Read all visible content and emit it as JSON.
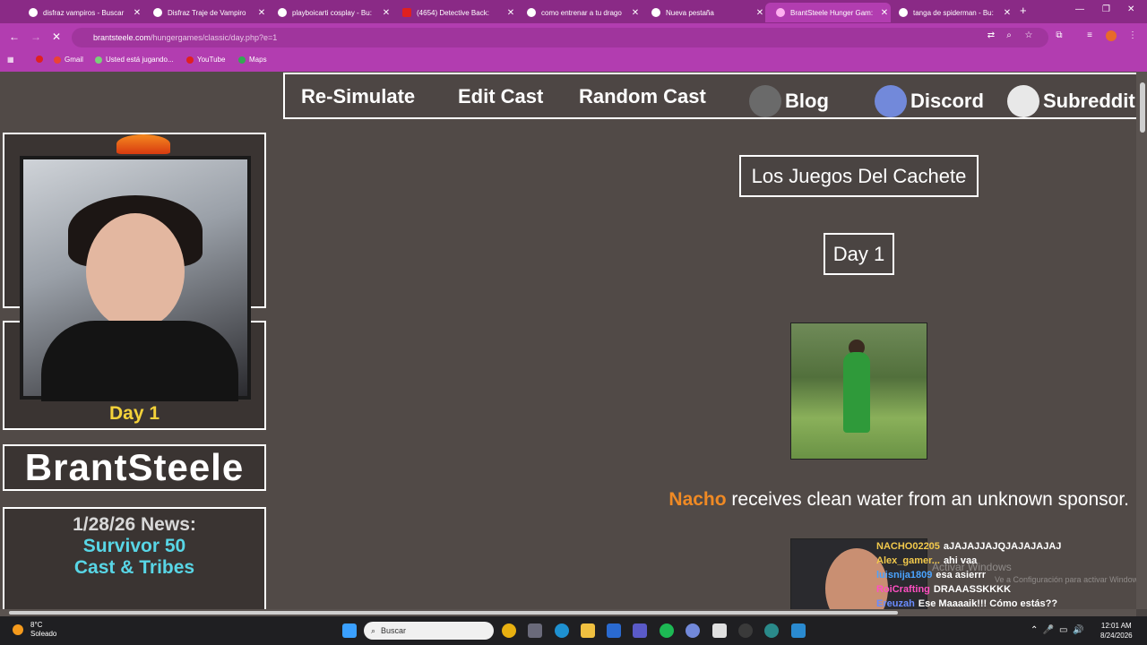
{
  "browser": {
    "tabs": [
      {
        "title": "disfraz vampiros - Buscar",
        "active": false
      },
      {
        "title": "Disfraz Traje de Vampiro",
        "active": false
      },
      {
        "title": "playboicarti cosplay - Bu:",
        "active": false
      },
      {
        "title": "(4654) Detective Back:",
        "active": false
      },
      {
        "title": "como entrenar a tu drago",
        "active": false
      },
      {
        "title": "Nueva pestaña",
        "active": false
      },
      {
        "title": "BrantSteele Hunger Gam:",
        "active": true
      },
      {
        "title": "tanga de spiderman - Bu:",
        "active": false
      }
    ],
    "url_domain": "brantsteele.com",
    "url_path": "/hungergames/classic/day.php?e=1",
    "bookmarks": [
      "Gmail",
      "Usted está jugando...",
      "YouTube",
      "Maps"
    ]
  },
  "site": {
    "nav": [
      "Re-Simulate",
      "Edit Cast",
      "Random Cast",
      "Blog",
      "Discord",
      "Subreddit"
    ],
    "sidebar_day": "Day 1",
    "logo_text": "BrantSteele",
    "news_header": "1/28/26 News:",
    "news_line1": "Survivor 50",
    "news_line2": "Cast & Tribes",
    "game_title": "Los Juegos Del Cachete",
    "day_title": "Day 1",
    "event_name": "Nacho",
    "event_text": " receives clean water from an unknown sponsor."
  },
  "stream_chat": [
    {
      "user": "NACHO02205",
      "msg": "aJAJAJJAJQJAJAJAJAJ",
      "color": "#f2c94c"
    },
    {
      "user": "Alex_gamer...",
      "msg": "ahi vaa",
      "color": "#f2c94c"
    },
    {
      "user": "luisnija1809",
      "msg": "esa asierrr",
      "color": "#4aa3ff"
    },
    {
      "user": "RoiCrafting",
      "msg": "DRAAASSKKKK",
      "color": "#ff4fc3"
    },
    {
      "user": "Ereuzah",
      "msg": "Ese Maaaaik!!! Cómo estás??",
      "color": "#6a8cff"
    }
  ],
  "watermark": {
    "line1": "Activar Windows",
    "line2": "Ve a Configuración para activar Windows."
  },
  "taskbar": {
    "temp": "8°C",
    "weather": "Soleado",
    "search_placeholder": "Buscar",
    "time": "12:01 AM",
    "date": "8/24/2026"
  },
  "colors": {
    "tabbar": "#8a2a86",
    "accent": "#b23db0",
    "event_name": "#f08a24",
    "news_highlight": "#58d6e6",
    "day_label": "#f4d23a"
  }
}
